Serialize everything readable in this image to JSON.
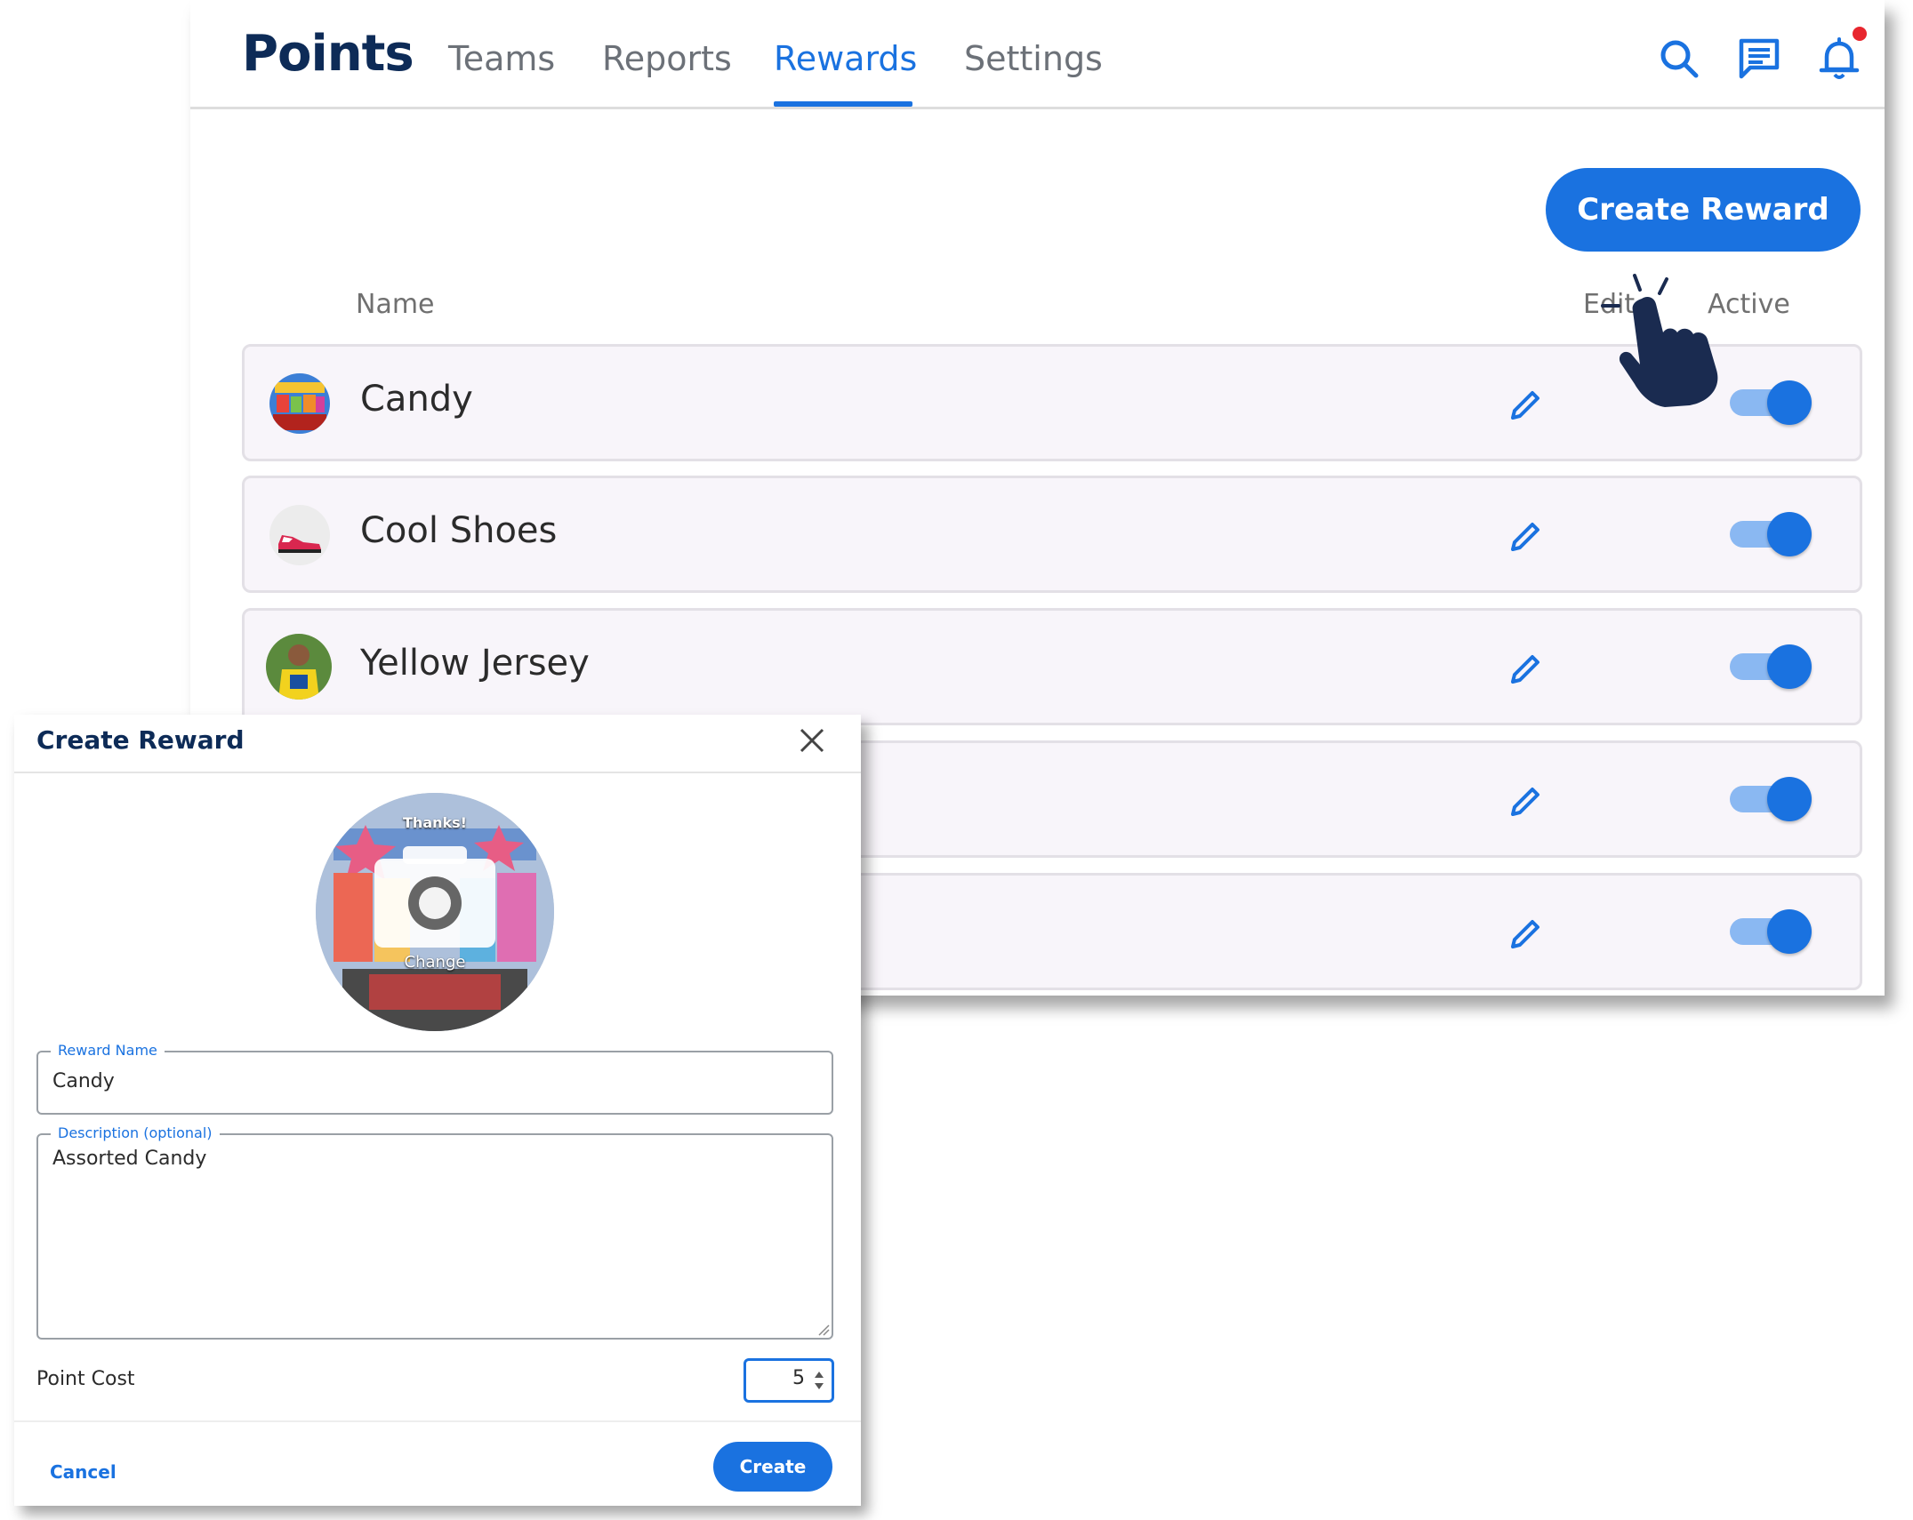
{
  "nav": {
    "brand": "Points",
    "tabs": [
      "Teams",
      "Reports",
      "Rewards",
      "Settings"
    ],
    "active_tab": "Rewards",
    "icons": [
      "search-icon",
      "chat-icon",
      "bell-icon"
    ]
  },
  "toolbar": {
    "create_reward_label": "Create Reward"
  },
  "table": {
    "headers": {
      "name": "Name",
      "edit": "Edit",
      "active": "Active"
    },
    "rows": [
      {
        "name": "Candy",
        "active": true
      },
      {
        "name": "Cool Shoes",
        "active": true
      },
      {
        "name": "Yellow Jersey",
        "active": true
      },
      {
        "name": "",
        "active": true
      },
      {
        "name": "",
        "active": true
      }
    ]
  },
  "modal": {
    "title": "Create Reward",
    "photo_caption": "Change",
    "photo_banner": "Thanks!",
    "reward_name_label": "Reward Name",
    "reward_name_value": "Candy",
    "description_label": "Description (optional)",
    "description_value": "Assorted Candy",
    "point_cost_label": "Point Cost",
    "point_cost_value": "5",
    "cancel_label": "Cancel",
    "create_label": "Create"
  },
  "colors": {
    "accent": "#1a72e0",
    "brand": "#0d2b57",
    "toggle_track": "#8ab8f2",
    "notification": "#e8262e"
  }
}
